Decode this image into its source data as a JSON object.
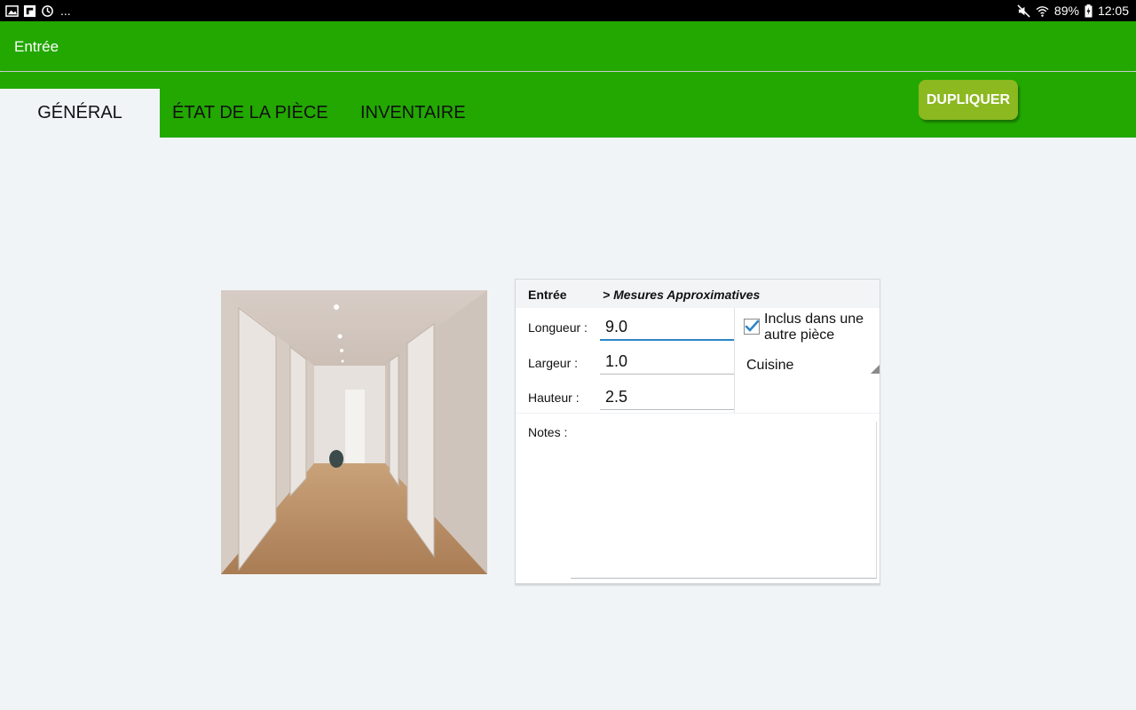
{
  "statusbar": {
    "dots": "...",
    "battery": "89%",
    "time": "12:05"
  },
  "appbar": {
    "title": "Entrée"
  },
  "tabs": [
    {
      "label": "GÉNÉRAL",
      "active": true
    },
    {
      "label": "ÉTAT DE LA PIÈCE",
      "active": false
    },
    {
      "label": "INVENTAIRE",
      "active": false
    }
  ],
  "duplicate_button": {
    "label": "DUPLIQUER"
  },
  "colors": {
    "primary": "#22a800",
    "accent_button": "#8cb820",
    "focus_underline": "#2d86c9",
    "background": "#f1f4f7",
    "checkbox": "#2d86c9"
  },
  "room_card": {
    "title": "Entrée",
    "subtitle": "> Mesures Approximatives",
    "fields": [
      {
        "label": "Longueur :",
        "value": "9.0"
      },
      {
        "label": "Largeur :",
        "value": "1.0"
      },
      {
        "label": "Hauteur :",
        "value": "2.5"
      }
    ],
    "included_checkbox": {
      "label": "Inclus dans une autre pièce",
      "checked": true
    },
    "parent_room_select": {
      "value": "Cuisine"
    },
    "notes": {
      "label": "Notes :",
      "value": ""
    }
  }
}
